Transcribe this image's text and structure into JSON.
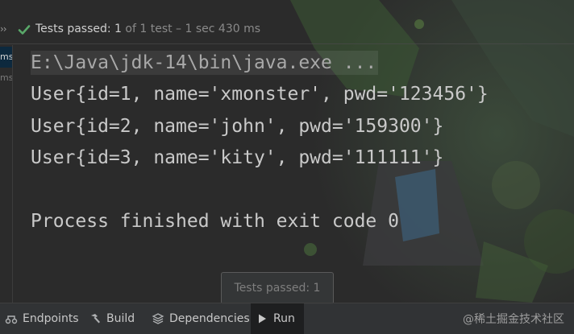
{
  "status": {
    "label": "Tests passed:",
    "passed": "1",
    "of_text": "of 1 test – 1 sec 430 ms",
    "chevron_glyph": "››"
  },
  "gutter": {
    "items": [
      "ms",
      "ms"
    ]
  },
  "console": {
    "lines": [
      "E:\\Java\\jdk-14\\bin\\java.exe ...",
      "User{id=1, name='xmonster', pwd='123456'}",
      "User{id=2, name='john', pwd='159300'}",
      "User{id=3, name='kity', pwd='111111'}",
      "",
      "Process finished with exit code 0"
    ]
  },
  "toast": {
    "text": "Tests passed: 1"
  },
  "toolbar": {
    "endpoints": "Endpoints",
    "build": "Build",
    "dependencies": "Dependencies",
    "run": "Run"
  },
  "watermark": "@稀土掘金技术社区",
  "colors": {
    "pass_green": "#59a869",
    "background": "#2b2b2b",
    "console_text": "#c9c9c9"
  }
}
